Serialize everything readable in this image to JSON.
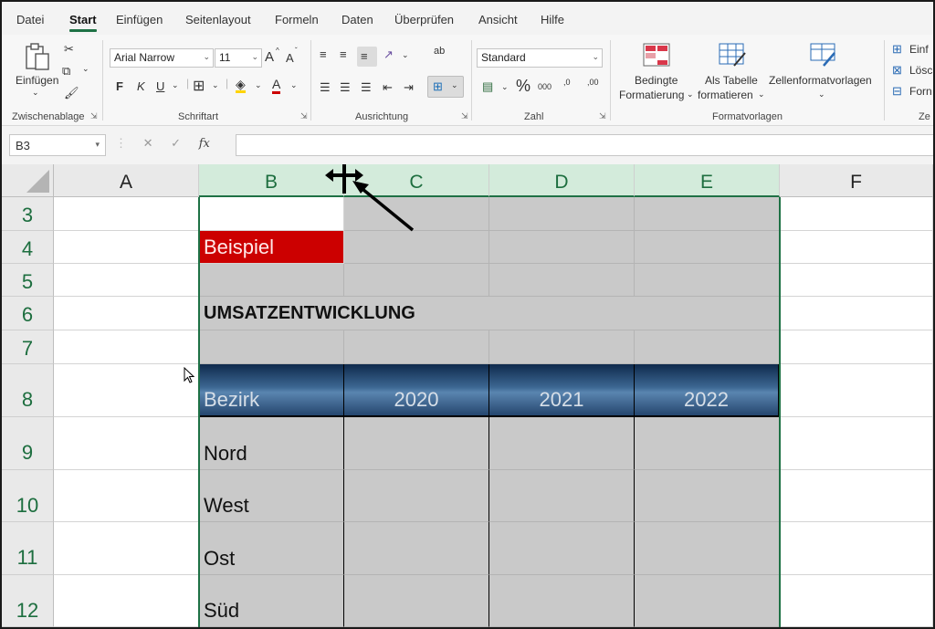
{
  "tabs": [
    "Datei",
    "Start",
    "Einfügen",
    "Seitenlayout",
    "Formeln",
    "Daten",
    "Überprüfen",
    "Ansicht",
    "Hilfe"
  ],
  "active_tab": "Start",
  "ribbon": {
    "clipboard": {
      "paste_label": "Einfügen",
      "group_label": "Zwischenablage"
    },
    "font": {
      "font_name": "Arial Narrow",
      "font_size": "11",
      "bold": "F",
      "italic": "K",
      "underline": "U",
      "grow": "A",
      "shrink": "A",
      "font_color": "A",
      "group_label": "Schriftart"
    },
    "alignment": {
      "wrap_icon": "ab",
      "group_label": "Ausrichtung"
    },
    "number": {
      "format": "Standard",
      "percent": "%",
      "thousands": "000",
      "inc_decimal": ",0",
      "dec_decimal": ",00",
      "group_label": "Zahl"
    },
    "styles": {
      "conditional_line1": "Bedingte",
      "conditional_line2": "Formatierung",
      "table_line1": "Als Tabelle",
      "table_line2": "formatieren",
      "cell_styles": "Zellenformatvorlagen",
      "group_label": "Formatvorlagen"
    },
    "cells": {
      "insert": "Einf",
      "delete": "Lösc",
      "format": "Forn",
      "group_label": "Ze"
    }
  },
  "formula_bar": {
    "name_box": "B3",
    "fx": "fx",
    "cancel": "✕",
    "enter": "✓",
    "formula": ""
  },
  "columns": [
    "A",
    "B",
    "C",
    "D",
    "E",
    "F"
  ],
  "rows": [
    "3",
    "4",
    "5",
    "6",
    "7",
    "8",
    "9",
    "10",
    "11",
    "12"
  ],
  "sheet": {
    "example_label": "Beispiel",
    "title": "UMSATZENTWICKLUNG",
    "table_header": [
      "Bezirk",
      "2020",
      "2021",
      "2022"
    ],
    "districts": [
      "Nord",
      "West",
      "Ost",
      "Süd"
    ]
  },
  "colors": {
    "accent": "#1e7145",
    "red": "#cc0000",
    "gray": "#c9c9c9",
    "header_blue": "#3c6792"
  }
}
